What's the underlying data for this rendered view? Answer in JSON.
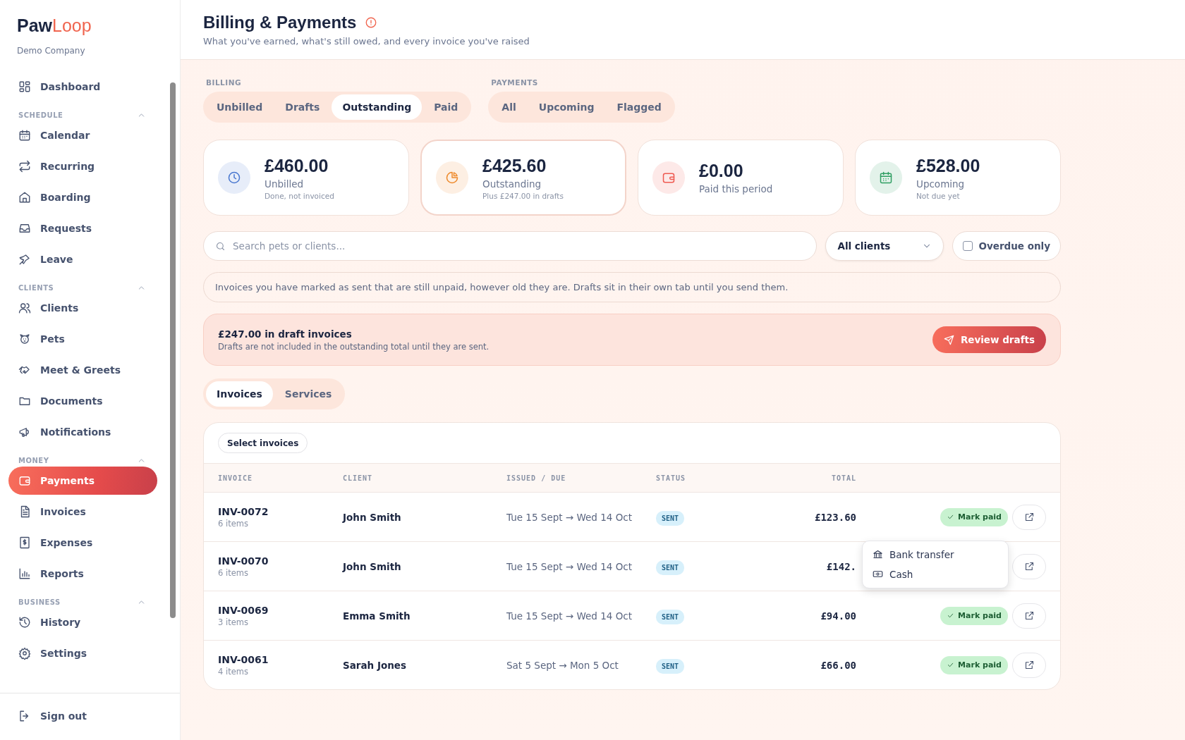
{
  "sidebar": {
    "logo": {
      "first": "Paw",
      "second": "Loop"
    },
    "company": "Demo Company",
    "top_items": [
      {
        "label": "Dashboard",
        "selected": false
      }
    ],
    "sections": [
      {
        "title": "SCHEDULE",
        "expanded": true,
        "items": [
          {
            "label": "Calendar",
            "selected": false
          },
          {
            "label": "Recurring",
            "selected": false
          },
          {
            "label": "Boarding",
            "selected": false
          },
          {
            "label": "Requests",
            "selected": false
          },
          {
            "label": "Leave",
            "selected": false
          }
        ]
      },
      {
        "title": "CLIENTS",
        "expanded": true,
        "items": [
          {
            "label": "Clients",
            "selected": false
          },
          {
            "label": "Pets",
            "selected": false
          },
          {
            "label": "Meet & Greets",
            "selected": false
          },
          {
            "label": "Documents",
            "selected": false
          },
          {
            "label": "Notifications",
            "selected": false
          }
        ]
      },
      {
        "title": "MONEY",
        "expanded": true,
        "items": [
          {
            "label": "Payments",
            "selected": true
          },
          {
            "label": "Invoices",
            "selected": false
          },
          {
            "label": "Expenses",
            "selected": false
          },
          {
            "label": "Reports",
            "selected": false
          }
        ]
      },
      {
        "title": "BUSINESS",
        "expanded": true,
        "items": [
          {
            "label": "History",
            "selected": false
          },
          {
            "label": "Settings",
            "selected": false
          }
        ]
      }
    ],
    "sign_out": "Sign out"
  },
  "header": {
    "title": "Billing & Payments",
    "subtitle": "What you've earned, what's still owed, and every invoice you've raised"
  },
  "tab_groups": [
    {
      "label": "BILLING",
      "tabs": [
        {
          "label": "Unbilled",
          "selected": false
        },
        {
          "label": "Drafts",
          "selected": false
        },
        {
          "label": "Outstanding",
          "selected": true
        },
        {
          "label": "Paid",
          "selected": false
        }
      ]
    },
    {
      "label": "PAYMENTS",
      "tabs": [
        {
          "label": "All",
          "selected": false
        },
        {
          "label": "Upcoming",
          "selected": false
        },
        {
          "label": "Flagged",
          "selected": false
        }
      ]
    }
  ],
  "stats": [
    {
      "amount": "£460.00",
      "label": "Unbilled",
      "note": "Done, not invoiced",
      "color": "#4a78d0",
      "selected": false
    },
    {
      "amount": "£425.60",
      "label": "Outstanding",
      "note": "Plus £247.00 in drafts",
      "color": "#ee8a2c",
      "selected": true
    },
    {
      "amount": "£0.00",
      "label": "Paid this period",
      "color": "#ef5b52",
      "selected": false
    },
    {
      "amount": "£528.00",
      "label": "Upcoming",
      "note": "Not due yet",
      "color": "#2f9e62",
      "selected": false
    }
  ],
  "filters": {
    "search": {
      "placeholder": "Search pets or clients..."
    },
    "client_select": "All clients",
    "overdue": {
      "label": "Overdue only",
      "checked": false
    }
  },
  "info": "Invoices you have marked as sent that are still unpaid, however old they are. Drafts sit in their own tab until you send them.",
  "draft_banner": {
    "title": "£247.00 in draft invoices",
    "text": "Drafts are not included in the outstanding total until they are sent.",
    "button": "Review drafts"
  },
  "view_tabs": [
    {
      "label": "Invoices",
      "selected": true
    },
    {
      "label": "Services",
      "selected": false
    }
  ],
  "table": {
    "select_button": "Select invoices",
    "columns": [
      "INVOICE",
      "CLIENT",
      "ISSUED / DUE",
      "STATUS",
      "TOTAL"
    ],
    "rows": [
      {
        "invoice": "INV-0072",
        "items": "6 items",
        "client": "John Smith",
        "dates": "Tue 15 Sept → Wed 14 Oct",
        "status": "SENT",
        "total": "£123.60",
        "mark_paid": "Mark paid",
        "payment_menu": [
          {
            "label": "Bank transfer"
          },
          {
            "label": "Cash"
          }
        ]
      },
      {
        "invoice": "INV-0070",
        "items": "6 items",
        "client": "John Smith",
        "dates": "Tue 15 Sept → Wed 14 Oct",
        "status": "SENT",
        "total": "£142."
      },
      {
        "invoice": "INV-0069",
        "items": "3 items",
        "client": "Emma Smith",
        "dates": "Tue 15 Sept → Wed 14 Oct",
        "status": "SENT",
        "total": "£94.00",
        "mark_paid": "Mark paid"
      },
      {
        "invoice": "INV-0061",
        "items": "4 items",
        "client": "Sarah Jones",
        "dates": "Sat 5 Sept → Mon 5 Oct",
        "status": "SENT",
        "total": "£66.00",
        "mark_paid": "Mark paid"
      }
    ]
  }
}
